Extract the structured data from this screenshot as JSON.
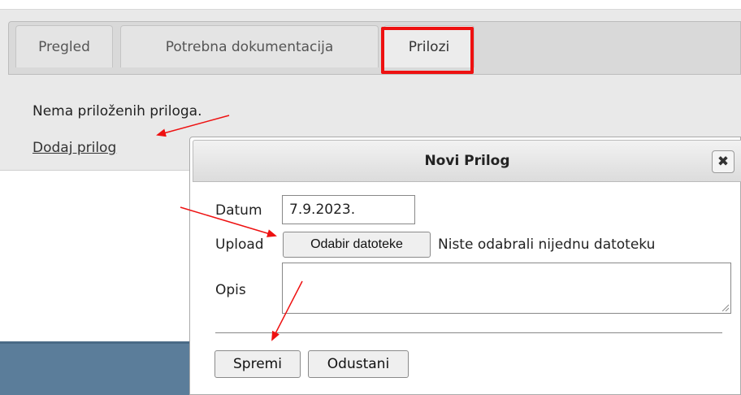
{
  "tabs": [
    {
      "label": "Pregled"
    },
    {
      "label": "Potrebna dokumentacija"
    },
    {
      "label": "Prilozi"
    }
  ],
  "attachments": {
    "empty_message": "Nema priloženih priloga.",
    "add_link": "Dodaj prilog"
  },
  "dialog": {
    "title": "Novi Prilog",
    "close_glyph": "✖",
    "date_label": "Datum",
    "date_value": "7.9.2023.",
    "upload_label": "Upload",
    "file_button": "Odabir datoteke",
    "file_status": "Niste odabrali nijednu datoteku",
    "description_label": "Opis",
    "description_value": "",
    "save_button": "Spremi",
    "cancel_button": "Odustani"
  },
  "colors": {
    "highlight": "#ee1111",
    "annotation_arrow": "#ee1111",
    "bottom_bar": "#5b7d9a"
  }
}
